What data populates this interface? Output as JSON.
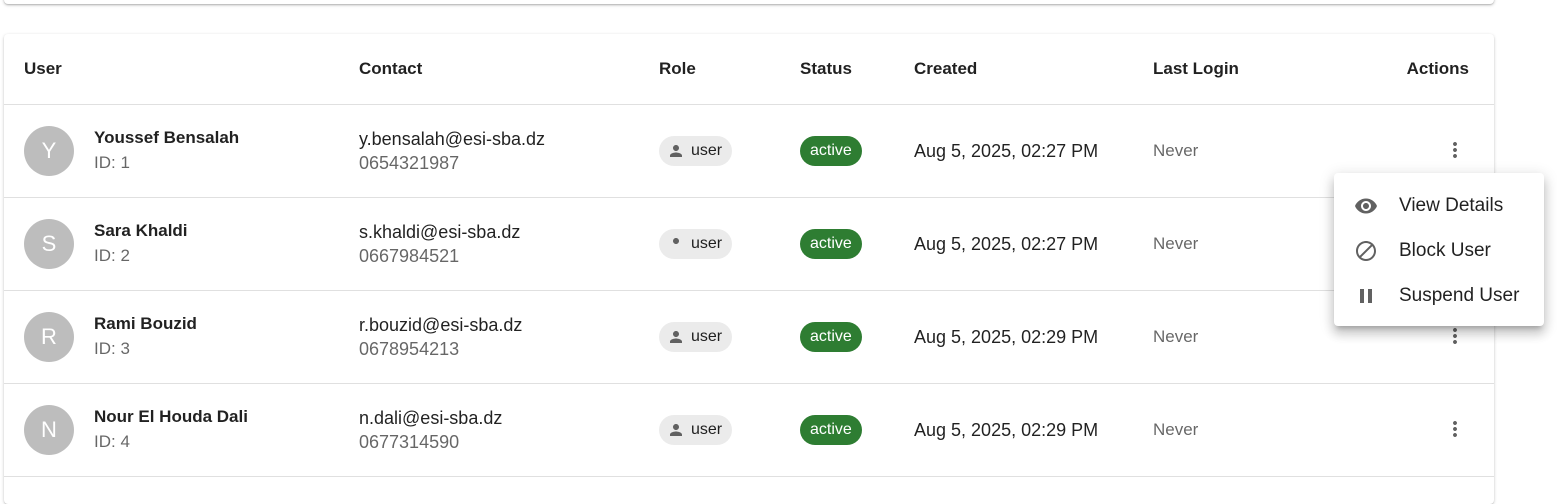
{
  "table": {
    "headers": {
      "user": "User",
      "contact": "Contact",
      "role": "Role",
      "status": "Status",
      "created": "Created",
      "last_login": "Last Login",
      "actions": "Actions"
    },
    "rows": [
      {
        "initial": "Y",
        "name": "Youssef Bensalah",
        "id": "ID: 1",
        "email": "y.bensalah@esi-sba.dz",
        "phone": "0654321987",
        "role": "user",
        "status": "active",
        "created": "Aug 5, 2025, 02:27 PM",
        "last_login": "Never"
      },
      {
        "initial": "S",
        "name": "Sara Khaldi",
        "id": "ID: 2",
        "email": "s.khaldi@esi-sba.dz",
        "phone": "0667984521",
        "role": "user",
        "status": "active",
        "created": "Aug 5, 2025, 02:27 PM",
        "last_login": "Never"
      },
      {
        "initial": "R",
        "name": "Rami Bouzid",
        "id": "ID: 3",
        "email": "r.bouzid@esi-sba.dz",
        "phone": "0678954213",
        "role": "user",
        "status": "active",
        "created": "Aug 5, 2025, 02:29 PM",
        "last_login": "Never"
      },
      {
        "initial": "N",
        "name": "Nour El Houda Dali",
        "id": "ID: 4",
        "email": "n.dali@esi-sba.dz",
        "phone": "0677314590",
        "role": "user",
        "status": "active",
        "created": "Aug 5, 2025, 02:29 PM",
        "last_login": "Never"
      }
    ]
  },
  "menu": {
    "items": [
      {
        "label": "View Details",
        "icon": "eye-icon"
      },
      {
        "label": "Block User",
        "icon": "block-icon"
      },
      {
        "label": "Suspend User",
        "icon": "pause-icon"
      }
    ]
  },
  "colors": {
    "status_active": "#2e7d32",
    "avatar": "#bdbdbd",
    "chip": "#ebebeb"
  }
}
